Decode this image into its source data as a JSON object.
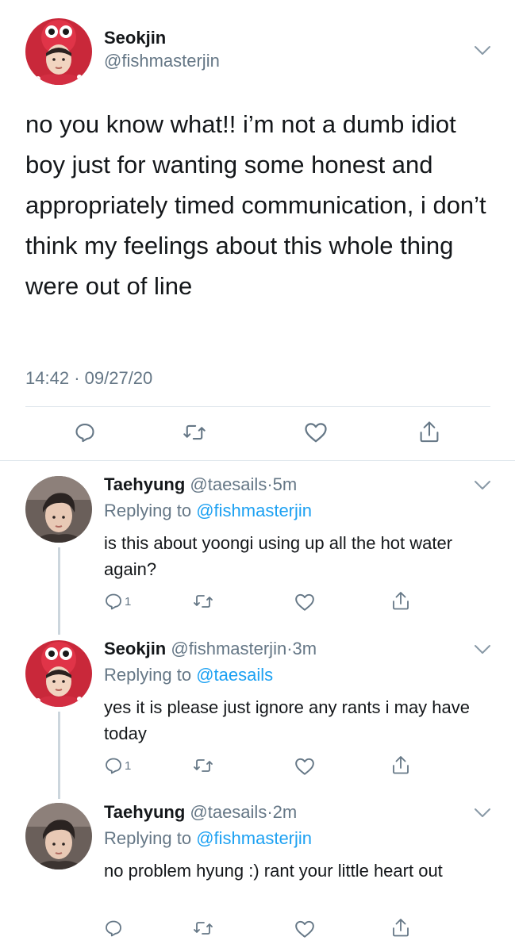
{
  "main_tweet": {
    "name": "Seokjin",
    "handle": "@fishmasterjin",
    "text": "no you know what!! i’m not a dumb idiot boy just for wanting some honest and appropriately timed communication, i don’t think my feelings about this whole thing were out of line",
    "time": "14:42",
    "separator": "·",
    "date": "09/27/20",
    "actions": [
      "reply-icon",
      "retweet-icon",
      "like-icon",
      "share-icon"
    ]
  },
  "replies": [
    {
      "name": "Taehyung",
      "handle": "@taesails",
      "separator": "·",
      "age": "5m",
      "replying_prefix": "Replying to",
      "replying_to": "@fishmasterjin",
      "text": "is this about yoongi using up all the hot water again?",
      "reply_count": "1"
    },
    {
      "name": "Seokjin",
      "handle": "@fishmasterjin",
      "separator": "·",
      "age": "3m",
      "replying_prefix": "Replying to",
      "replying_to": "@taesails",
      "text": "yes it is please just ignore any rants i may have today",
      "reply_count": "1"
    },
    {
      "name": "Taehyung",
      "handle": "@taesails",
      "separator": "·",
      "age": "2m",
      "replying_prefix": "Replying to",
      "replying_to": "@fishmasterjin",
      "text": "no problem hyung :) rant your little heart out",
      "reply_count": ""
    }
  ],
  "colors": {
    "text": "#14171a",
    "secondary": "#657786",
    "link": "#1da1f2",
    "divider": "#e1e8ed",
    "thread_line": "#ccd6dd"
  }
}
